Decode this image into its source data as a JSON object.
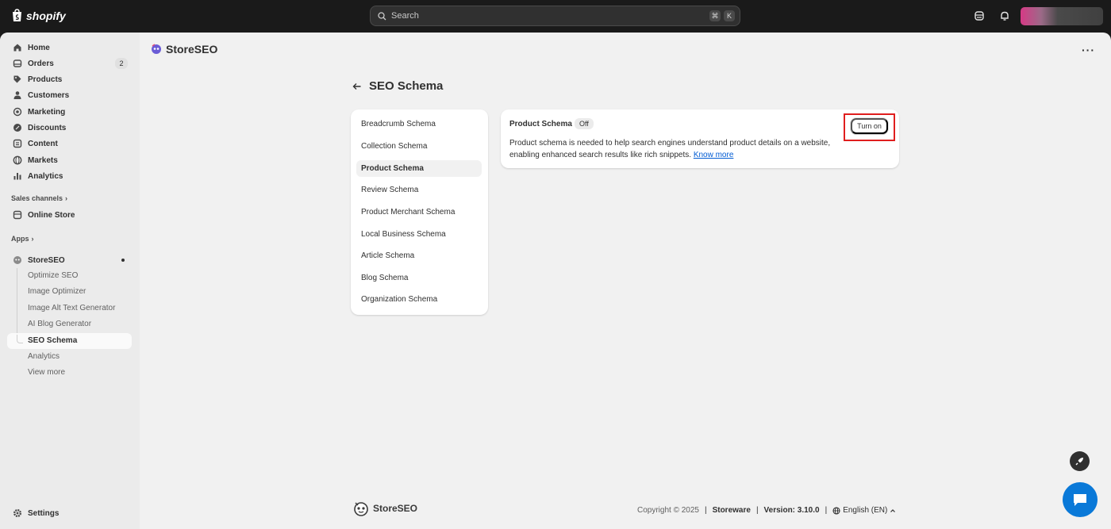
{
  "topbar": {
    "brand": "shopify",
    "search_placeholder": "Search",
    "shortcut_cmd": "⌘",
    "shortcut_key": "K"
  },
  "sidebar": {
    "items": [
      {
        "label": "Home",
        "icon": "home-icon"
      },
      {
        "label": "Orders",
        "icon": "orders-icon",
        "badge": "2"
      },
      {
        "label": "Products",
        "icon": "tag-icon"
      },
      {
        "label": "Customers",
        "icon": "person-icon"
      },
      {
        "label": "Marketing",
        "icon": "target-icon"
      },
      {
        "label": "Discounts",
        "icon": "discount-icon"
      },
      {
        "label": "Content",
        "icon": "content-icon"
      },
      {
        "label": "Markets",
        "icon": "globe-icon"
      },
      {
        "label": "Analytics",
        "icon": "bar-chart-icon"
      }
    ],
    "sales_channels_label": "Sales channels",
    "online_store_label": "Online Store",
    "apps_label": "Apps",
    "app_name": "StoreSEO",
    "app_subitems": [
      "Optimize SEO",
      "Image Optimizer",
      "Image Alt Text Generator",
      "AI Blog Generator",
      "SEO Schema",
      "Analytics",
      "View more"
    ],
    "active_subitem": "SEO Schema",
    "settings_label": "Settings"
  },
  "main": {
    "app_title": "StoreSEO",
    "page_title": "SEO Schema",
    "schema_list": [
      "Breadcrumb Schema",
      "Collection Schema",
      "Product Schema",
      "Review Schema",
      "Product Merchant Schema",
      "Local Business Schema",
      "Article Schema",
      "Blog Schema",
      "Organization Schema"
    ],
    "active_schema": "Product Schema",
    "card": {
      "title": "Product Schema",
      "status": "Off",
      "description": "Product schema is needed to help search engines understand product details on a website, enabling enhanced search results like rich snippets.",
      "link": "Know more",
      "button": "Turn on"
    }
  },
  "footer": {
    "logo_text": "StoreSEO",
    "copyright": "Copyright © 2025",
    "company": "Storeware",
    "version": "Version: 3.10.0",
    "language": "English (EN)"
  },
  "colors": {
    "topbar": "#1a1a1a",
    "link": "#005bd3",
    "highlight": "#e01e1e",
    "chat": "#0a79d8"
  }
}
